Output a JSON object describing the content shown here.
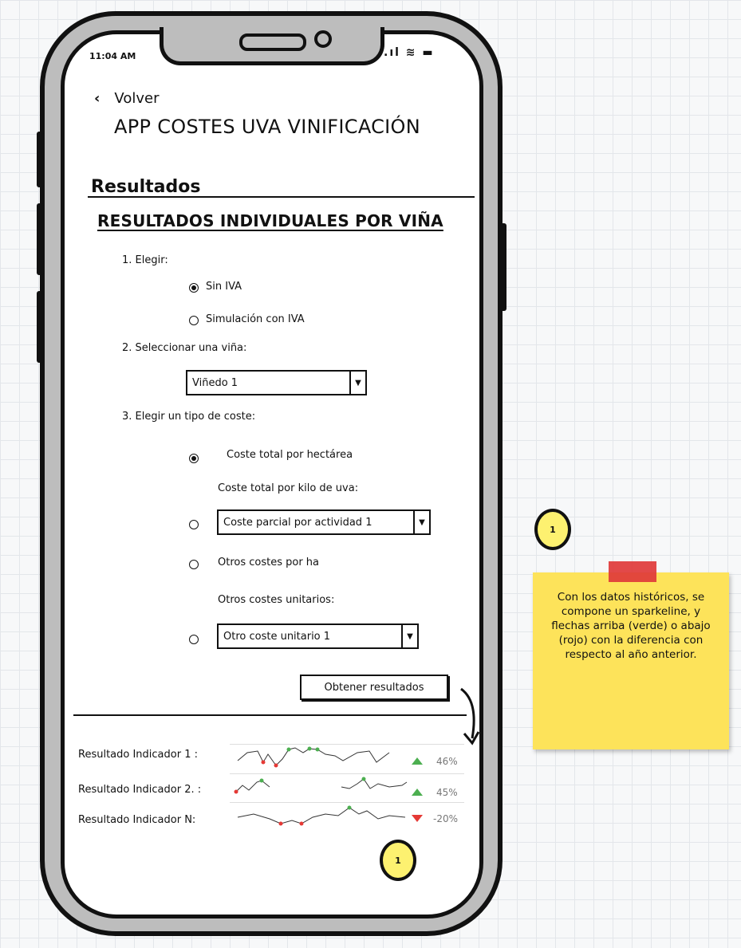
{
  "status": {
    "time": "11:04 AM",
    "icons": ".ıl ≋ ▬"
  },
  "nav": {
    "back_label": "Volver"
  },
  "app_title": "APP COSTES UVA VINIFICACIÓN",
  "section_title": "Resultados",
  "subtitle": "RESULTADOS INDIVIDUALES POR VIÑA",
  "step1": {
    "label": "1. Elegir:",
    "options": [
      {
        "label": "Sin IVA",
        "selected": true
      },
      {
        "label": "Simulación con IVA",
        "selected": false
      }
    ]
  },
  "step2": {
    "label": "2. Seleccionar una viña:",
    "select_value": "Viñedo 1"
  },
  "step3": {
    "label": "3. Elegir un tipo de coste:",
    "opt_total_ha": "Coste total por hectárea",
    "label_total_kilo": "Coste total por kilo de uva:",
    "select_parcial": "Coste parcial por actividad 1",
    "opt_otros_ha": "Otros costes por ha",
    "label_otros_unit": "Otros costes unitarios:",
    "select_otro_unit": "Otro coste unitario 1"
  },
  "button_obtener": "Obtener resultados",
  "indicators": [
    {
      "label": "Resultado Indicador 1 :",
      "trend": "up",
      "pct": "46%"
    },
    {
      "label": "Resultado Indicador 2. :",
      "trend": "up",
      "pct": "45%"
    },
    {
      "label": "Resultado Indicador N:",
      "trend": "down",
      "pct": "-20%"
    }
  ],
  "note": {
    "text": "Con los datos históricos, se compone un sparkeline, y flechas arriba (verde) o abajo (rojo) con la diferencia con respecto al año anterior."
  },
  "callouts": {
    "badge": "1"
  },
  "colors": {
    "up": "#4caf50",
    "down": "#e53935",
    "sticky": "#fde35a",
    "tape": "#e03a3a"
  }
}
